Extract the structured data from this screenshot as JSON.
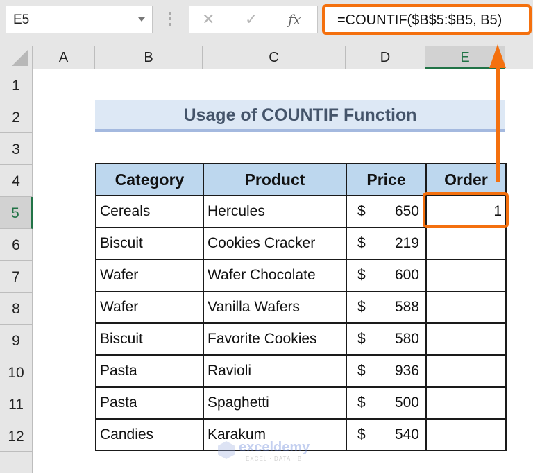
{
  "formula_bar": {
    "name_box": "E5",
    "cancel_icon": "✕",
    "enter_icon": "✓",
    "fx_icon": "fx",
    "formula": "=COUNTIF($B$5:$B5, B5)"
  },
  "columns": [
    "A",
    "B",
    "C",
    "D",
    "E"
  ],
  "selected_column": "E",
  "rows": [
    "1",
    "2",
    "3",
    "4",
    "5",
    "6",
    "7",
    "8",
    "9",
    "10",
    "11",
    "12"
  ],
  "selected_row": "5",
  "sheet": {
    "title": "Usage of COUNTIF Function",
    "headers": [
      "Category",
      "Product",
      "Price",
      "Order"
    ],
    "currency_symbol": "$",
    "records": [
      {
        "category": "Cereals",
        "product": "Hercules",
        "price": "650",
        "order": "1"
      },
      {
        "category": "Biscuit",
        "product": "Cookies Cracker",
        "price": "219",
        "order": ""
      },
      {
        "category": "Wafer",
        "product": "Wafer Chocolate",
        "price": "600",
        "order": ""
      },
      {
        "category": "Wafer",
        "product": "Vanilla Wafers",
        "price": "588",
        "order": ""
      },
      {
        "category": "Biscuit",
        "product": "Favorite Cookies",
        "price": "580",
        "order": ""
      },
      {
        "category": "Pasta",
        "product": "Ravioli",
        "price": "936",
        "order": ""
      },
      {
        "category": "Pasta",
        "product": "Spaghetti",
        "price": "500",
        "order": ""
      },
      {
        "category": "Candies",
        "product": "Karakum",
        "price": "540",
        "order": ""
      }
    ]
  },
  "annotation": {
    "color": "#f4700e"
  },
  "watermark": {
    "name": "exceldemy",
    "tagline": "EXCEL · DATA · BI"
  }
}
